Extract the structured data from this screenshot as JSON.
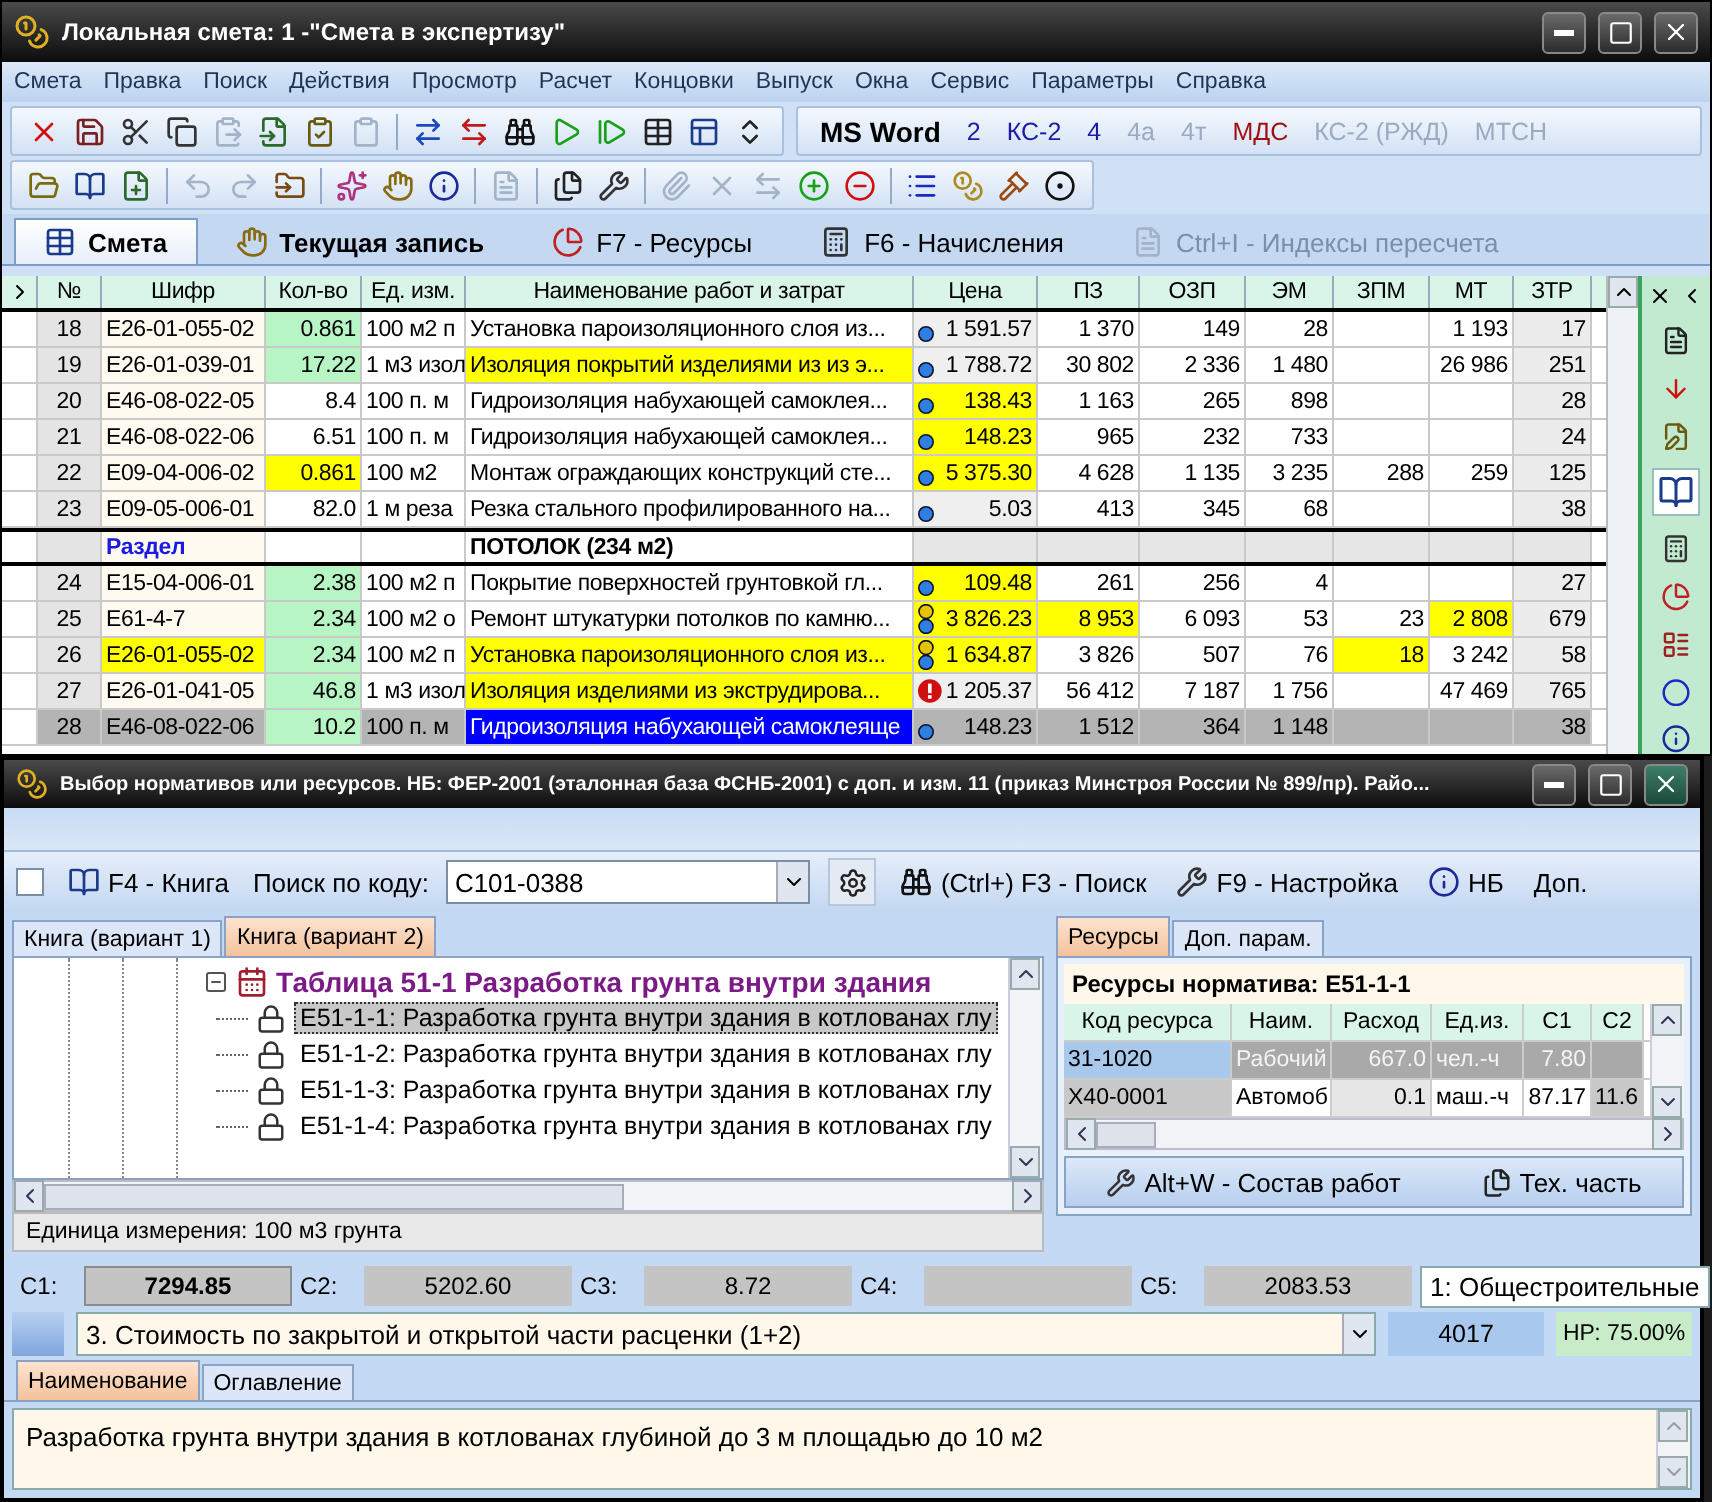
{
  "main_window": {
    "title": "Локальная смета: 1 -\"Смета в экспертизу\"",
    "menu": [
      "Смета",
      "Правка",
      "Поиск",
      "Действия",
      "Просмотр",
      "Расчет",
      "Концовки",
      "Выпуск",
      "Окна",
      "Сервис",
      "Параметры",
      "Справка"
    ],
    "toolbar_text_buttons": [
      {
        "label": "MS Word",
        "kind": "word",
        "disabled": false
      },
      {
        "label": "2",
        "kind": "form",
        "disabled": false
      },
      {
        "label": "КС-2",
        "kind": "form",
        "disabled": false
      },
      {
        "label": "4",
        "kind": "form",
        "disabled": false
      },
      {
        "label": "4а",
        "kind": "form",
        "disabled": true
      },
      {
        "label": "4т",
        "kind": "form",
        "disabled": true
      },
      {
        "label": "МДС",
        "kind": "norm",
        "disabled": false
      },
      {
        "label": "КС-2 (РЖД)",
        "kind": "form",
        "disabled": true
      },
      {
        "label": "МТСН",
        "kind": "form",
        "disabled": true
      }
    ],
    "tabs": [
      {
        "label": "Смета",
        "selected": true,
        "disabled": false,
        "emphasis": true
      },
      {
        "label": "Текущая запись",
        "selected": false,
        "disabled": false,
        "emphasis": true
      },
      {
        "label": "F7 - Ресурсы",
        "selected": false,
        "disabled": false,
        "emphasis": false
      },
      {
        "label": "F6 - Начисления",
        "selected": false,
        "disabled": false,
        "emphasis": false
      },
      {
        "label": "Ctrl+I - Индексы пересчета",
        "selected": false,
        "disabled": true,
        "emphasis": false
      }
    ],
    "grid": {
      "columns": [
        "№",
        "Шифр",
        "Кол-во",
        "Ед. изм.",
        "Наименование работ и затрат",
        "Цена",
        "ПЗ",
        "ОЗП",
        "ЭМ",
        "ЗПМ",
        "МТ",
        "ЗТР"
      ],
      "rows": [
        {
          "kind": "item",
          "num": "18",
          "code": {
            "text": "E26-01-055-02",
            "highlighted": false
          },
          "qty": {
            "text": "0.861",
            "color": "#b8f5c4"
          },
          "unit": "100 м2 п",
          "name": {
            "text": "Установка пароизоляционного слоя из...",
            "highlighted": false
          },
          "price": {
            "kind": "ball",
            "text": "1 591.57",
            "highlighted": false
          },
          "pz": {
            "text": "1 370",
            "highlighted": false
          },
          "ozp": {
            "text": "149",
            "highlighted": false
          },
          "em": {
            "text": "28",
            "highlighted": false
          },
          "zpm": {
            "highlighted": false
          },
          "mt": {
            "text": "1 193",
            "highlighted": false
          },
          "ztr": "17",
          "selected": false
        },
        {
          "kind": "item",
          "num": "19",
          "code": {
            "text": "E26-01-039-01",
            "highlighted": false
          },
          "qty": {
            "text": "17.22",
            "color": "#b8f5c4"
          },
          "unit": "1 м3 изол",
          "name": {
            "text": "Изоляция покрытий изделиями из из э...",
            "highlighted": true
          },
          "price": {
            "kind": "ball",
            "text": "1 788.72",
            "highlighted": false
          },
          "pz": {
            "text": "30 802",
            "highlighted": false
          },
          "ozp": {
            "text": "2 336",
            "highlighted": false
          },
          "em": {
            "text": "1 480",
            "highlighted": false
          },
          "zpm": {
            "highlighted": false
          },
          "mt": {
            "text": "26 986",
            "highlighted": false
          },
          "ztr": "251",
          "selected": false
        },
        {
          "kind": "item",
          "num": "20",
          "code": {
            "text": "E46-08-022-05",
            "highlighted": false
          },
          "qty": {
            "text": "8.4",
            "color": "#ffffff"
          },
          "unit": "100 п. м",
          "name": {
            "text": "Гидроизоляция набухающей самоклея...",
            "highlighted": false
          },
          "price": {
            "kind": "ball",
            "text": "138.43",
            "highlighted": true
          },
          "pz": {
            "text": "1 163",
            "highlighted": false
          },
          "ozp": {
            "text": "265",
            "highlighted": false
          },
          "em": {
            "text": "898",
            "highlighted": false
          },
          "zpm": {
            "highlighted": false
          },
          "mt": {
            "highlighted": false
          },
          "ztr": "28",
          "selected": false
        },
        {
          "kind": "item",
          "num": "21",
          "code": {
            "text": "E46-08-022-06",
            "highlighted": false
          },
          "qty": {
            "text": "6.51",
            "color": "#ffffff"
          },
          "unit": "100 п. м",
          "name": {
            "text": "Гидроизоляция набухающей самоклея...",
            "highlighted": false
          },
          "price": {
            "kind": "ball",
            "text": "148.23",
            "highlighted": true
          },
          "pz": {
            "text": "965",
            "highlighted": false
          },
          "ozp": {
            "text": "232",
            "highlighted": false
          },
          "em": {
            "text": "733",
            "highlighted": false
          },
          "zpm": {
            "highlighted": false
          },
          "mt": {
            "highlighted": false
          },
          "ztr": "24",
          "selected": false
        },
        {
          "kind": "item",
          "num": "22",
          "code": {
            "text": "E09-04-006-02",
            "highlighted": false
          },
          "qty": {
            "text": "0.861",
            "color": "#ffff00"
          },
          "unit": "100 м2",
          "name": {
            "text": "Монтаж ограждающих конструкций сте...",
            "highlighted": false
          },
          "price": {
            "kind": "ball",
            "text": "5 375.30",
            "highlighted": true
          },
          "pz": {
            "text": "4 628",
            "highlighted": false
          },
          "ozp": {
            "text": "1 135",
            "highlighted": false
          },
          "em": {
            "text": "3 235",
            "highlighted": false
          },
          "zpm": {
            "text": "288",
            "highlighted": false
          },
          "mt": {
            "text": "259",
            "highlighted": false
          },
          "ztr": "125",
          "selected": false
        },
        {
          "kind": "item",
          "num": "23",
          "code": {
            "text": "E09-05-006-01",
            "highlighted": false
          },
          "qty": {
            "text": "82.0",
            "color": "#ffffff"
          },
          "unit": "1 м реза",
          "name": {
            "text": "Резка стального профилированного на...",
            "highlighted": false
          },
          "price": {
            "kind": "ball",
            "text": "5.03",
            "highlighted": false
          },
          "pz": {
            "text": "413",
            "highlighted": false
          },
          "ozp": {
            "text": "345",
            "highlighted": false
          },
          "em": {
            "text": "68",
            "highlighted": false
          },
          "zpm": {
            "highlighted": false
          },
          "mt": {
            "highlighted": false
          },
          "ztr": "38",
          "selected": false
        },
        {
          "kind": "section",
          "code": "Раздел",
          "name": "ПОТОЛОК (234 м2)",
          "selected": false
        },
        {
          "kind": "item",
          "num": "24",
          "code": {
            "text": "E15-04-006-01",
            "highlighted": false
          },
          "qty": {
            "text": "2.38",
            "color": "#b8f5c4"
          },
          "unit": "100 м2 п",
          "name": {
            "text": "Покрытие поверхностей грунтовкой гл...",
            "highlighted": false
          },
          "price": {
            "kind": "ball",
            "text": "109.48",
            "highlighted": true
          },
          "pz": {
            "text": "261",
            "highlighted": false
          },
          "ozp": {
            "text": "256",
            "highlighted": false
          },
          "em": {
            "text": "4",
            "highlighted": false
          },
          "zpm": {
            "highlighted": false
          },
          "mt": {
            "highlighted": false
          },
          "ztr": "27",
          "selected": false
        },
        {
          "kind": "item",
          "num": "25",
          "code": {
            "text": "E61-4-7",
            "highlighted": false
          },
          "qty": {
            "text": "2.34",
            "color": "#b8f5c4"
          },
          "unit": "100 м2 о",
          "name": {
            "text": "Ремонт штукатурки потолков по камню...",
            "highlighted": false
          },
          "price": {
            "kind": "stacked",
            "text": "3 826.23",
            "highlighted": true
          },
          "pz": {
            "text": "8 953",
            "highlighted": true
          },
          "ozp": {
            "text": "6 093",
            "highlighted": false
          },
          "em": {
            "text": "53",
            "highlighted": false
          },
          "zpm": {
            "text": "23",
            "highlighted": false
          },
          "mt": {
            "text": "2 808",
            "highlighted": true
          },
          "ztr": "679",
          "selected": false
        },
        {
          "kind": "item",
          "num": "26",
          "code": {
            "text": "E26-01-055-02",
            "highlighted": true
          },
          "qty": {
            "text": "2.34",
            "color": "#b8f5c4"
          },
          "unit": "100 м2 п",
          "name": {
            "text": "Установка пароизоляционного слоя из...",
            "highlighted": true
          },
          "price": {
            "kind": "stacked",
            "text": "1 634.87",
            "highlighted": true
          },
          "pz": {
            "text": "3 826",
            "highlighted": false
          },
          "ozp": {
            "text": "507",
            "highlighted": false
          },
          "em": {
            "text": "76",
            "highlighted": false
          },
          "zpm": {
            "text": "18",
            "highlighted": true
          },
          "mt": {
            "text": "3 242",
            "highlighted": false
          },
          "ztr": "58",
          "selected": false
        },
        {
          "kind": "item",
          "num": "27",
          "code": {
            "text": "E26-01-041-05",
            "highlighted": false
          },
          "qty": {
            "text": "46.8",
            "color": "#b8f5c4"
          },
          "unit": "1 м3 изол",
          "name": {
            "text": "Изоляция изделиями из экструдирова...",
            "highlighted": true
          },
          "price": {
            "kind": "alert",
            "text": "1 205.37",
            "highlighted": false
          },
          "pz": {
            "text": "56 412",
            "highlighted": false
          },
          "ozp": {
            "text": "7 187",
            "highlighted": false
          },
          "em": {
            "text": "1 756",
            "highlighted": false
          },
          "zpm": {
            "highlighted": false
          },
          "mt": {
            "text": "47 469",
            "highlighted": false
          },
          "ztr": "765",
          "selected": false
        },
        {
          "kind": "item",
          "num": "28",
          "code": {
            "text": "E46-08-022-06",
            "highlighted": false
          },
          "qty": {
            "text": "10.2",
            "color": "#b8f5c4"
          },
          "unit": "100 п. м",
          "name": {
            "text": "Гидроизоляция набухающей самоклеяще",
            "highlighted": false
          },
          "price": {
            "kind": "ball",
            "text": "148.23",
            "highlighted": false
          },
          "pz": {
            "text": "1 512",
            "highlighted": false
          },
          "ozp": {
            "text": "364",
            "highlighted": false
          },
          "em": {
            "text": "1 148",
            "highlighted": false
          },
          "zpm": {
            "highlighted": false
          },
          "mt": {
            "highlighted": false
          },
          "ztr": "38",
          "selected": true
        }
      ]
    }
  },
  "dialog": {
    "title": "Выбор нормативов или ресурсов. НБ: ФЕР-2001 (эталонная база ФСНБ-2001) с доп. и изм. 11 (приказ Минстроя России № 899/пр). Райо...",
    "toolbar": {
      "checked": false,
      "book_button": "F4 - Книга",
      "search_label": "Поиск по коду:",
      "search_value": "С101-0388",
      "find_button": "(Ctrl+) F3 - Поиск",
      "settings_button": "F9 - Настройка",
      "base_button": "НБ",
      "more_button": "Доп."
    },
    "book_tabs": [
      {
        "label": "Книга (вариант 1)",
        "selected": false
      },
      {
        "label": "Книга (вариант 2)",
        "selected": true
      }
    ],
    "tree": {
      "label": "Таблица 51-1 Разработка грунта внутри здания",
      "expanded": true,
      "children": [
        {
          "label": "E51-1-1: Разработка грунта внутри здания в котлованах глу",
          "selected": true
        },
        {
          "label": "E51-1-2: Разработка грунта внутри здания в котлованах глу",
          "selected": false
        },
        {
          "label": "E51-1-3: Разработка грунта внутри здания в котлованах глу",
          "selected": false
        },
        {
          "label": "E51-1-4: Разработка грунта внутри здания в котлованах глу",
          "selected": false
        }
      ]
    },
    "unit_status": "Единица измерения: 100 м3 грунта",
    "resource_tabs": [
      {
        "label": "Ресурсы",
        "selected": true
      },
      {
        "label": "Доп. парам.",
        "selected": false
      }
    ],
    "resources": {
      "title": "Ресурсы норматива: E51-1-1",
      "columns": [
        "Код ресурса",
        "Наим.",
        "Расход",
        "Ед.из.",
        "С1",
        "С2"
      ],
      "rows": [
        {
          "cells": [
            "31-1020",
            "Рабочий",
            "667.0",
            "чел.-ч",
            "7.80",
            null
          ],
          "selected": true
        },
        {
          "cells": [
            "Х40-0001",
            "Автомоб",
            "0.1",
            "маш.-ч",
            "87.17",
            "11.6"
          ],
          "selected": false
        }
      ]
    },
    "resource_buttons": [
      "Alt+W - Состав работ",
      "Тех. часть"
    ],
    "totals": [
      {
        "label": "С1:",
        "value": "7294.85",
        "emphasis": true
      },
      {
        "label": "С2:",
        "value": "5202.60",
        "emphasis": false
      },
      {
        "label": "С3:",
        "value": "8.72",
        "emphasis": false
      },
      {
        "label": "С4:",
        "emphasis": false
      },
      {
        "label": "С5:",
        "value": "2083.53",
        "emphasis": false
      }
    ],
    "category": "1: Общестроительные",
    "calc_mode": "3. Стоимость по закрытой и открытой части расценки (1+2)",
    "code_count": "4017",
    "overhead": "НР: 75.00%",
    "text_tabs": [
      {
        "label": "Наименование",
        "selected": true
      },
      {
        "label": "Оглавление",
        "selected": false
      }
    ],
    "description": "Разработка грунта внутри здания в котлованах глубиной до 3 м площадью до 10 м2"
  }
}
